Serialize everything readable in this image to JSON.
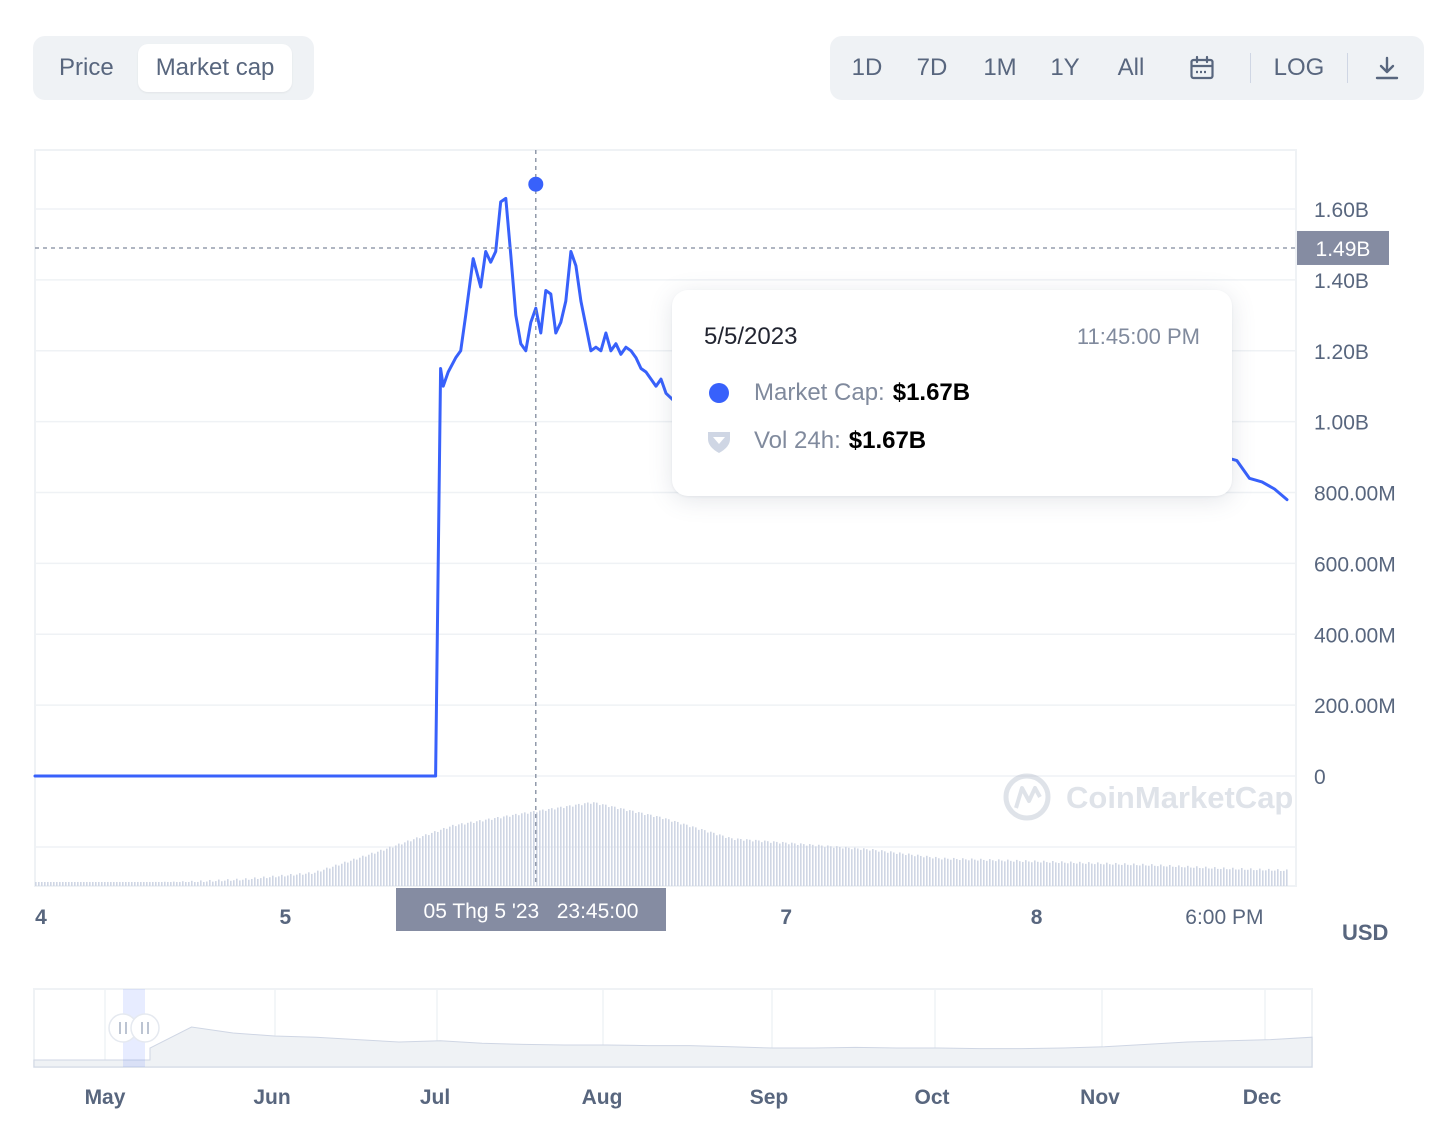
{
  "toggle": {
    "items": [
      {
        "label": "Price",
        "active": false
      },
      {
        "label": "Market cap",
        "active": true
      }
    ]
  },
  "range": {
    "items": [
      "1D",
      "7D",
      "1M",
      "1Y",
      "All"
    ],
    "calendar_icon": "calendar-icon",
    "log_label": "LOG",
    "download_icon": "download-icon"
  },
  "tooltip": {
    "date": "5/5/2023",
    "time": "11:45:00 PM",
    "market_cap_label": "Market Cap:",
    "market_cap_value": "$1.67B",
    "vol_label": "Vol 24h:",
    "vol_value": "$1.67B"
  },
  "currency": "USD",
  "watermark": "CoinMarketCap",
  "colors": {
    "line": "#3861fb",
    "axis_text": "#58667e",
    "grid": "#eff2f5",
    "crosshair_label_bg": "#858ca2",
    "volume": "#cfd6e4",
    "navigator_fill": "#eff2f5"
  },
  "chart_data": {
    "type": "line",
    "series": [
      {
        "name": "Market Cap",
        "x": [
          4.0,
          5.6,
          5.62,
          5.63,
          5.65,
          5.68,
          5.7,
          5.72,
          5.75,
          5.78,
          5.8,
          5.82,
          5.84,
          5.86,
          5.88,
          5.9,
          5.92,
          5.94,
          5.96,
          5.98,
          6.0,
          6.02,
          6.04,
          6.06,
          6.08,
          6.1,
          6.12,
          6.14,
          6.16,
          6.18,
          6.2,
          6.22,
          6.24,
          6.26,
          6.28,
          6.3,
          6.32,
          6.34,
          6.36,
          6.38,
          6.4,
          6.42,
          6.44,
          6.46,
          6.48,
          6.5,
          6.52,
          6.55,
          6.6,
          6.7,
          6.8,
          6.9,
          7.0,
          7.1,
          7.2,
          7.3,
          7.4,
          7.5,
          7.6,
          7.7,
          7.8,
          7.9,
          8.0,
          8.1,
          8.2,
          8.3,
          8.4,
          8.5,
          8.6,
          8.7,
          8.75,
          8.8,
          8.85,
          8.9,
          8.95,
          9.0
        ],
        "y": [
          0,
          0,
          1.15,
          1.1,
          1.14,
          1.18,
          1.2,
          1.3,
          1.46,
          1.38,
          1.48,
          1.45,
          1.48,
          1.62,
          1.63,
          1.47,
          1.3,
          1.22,
          1.2,
          1.28,
          1.32,
          1.25,
          1.37,
          1.36,
          1.25,
          1.28,
          1.34,
          1.48,
          1.44,
          1.34,
          1.27,
          1.2,
          1.21,
          1.2,
          1.25,
          1.2,
          1.22,
          1.19,
          1.21,
          1.2,
          1.18,
          1.15,
          1.14,
          1.12,
          1.1,
          1.12,
          1.08,
          1.06,
          1.04,
          1.02,
          1.0,
          0.99,
          0.98,
          0.97,
          0.97,
          0.96,
          0.95,
          0.95,
          0.94,
          0.94,
          0.93,
          0.93,
          0.92,
          0.92,
          0.92,
          0.91,
          0.92,
          0.91,
          0.91,
          0.92,
          0.9,
          0.89,
          0.84,
          0.83,
          0.81,
          0.78
        ]
      }
    ],
    "volume_profile": [
      0.02,
      0.02,
      0.03,
      0.06,
      0.12,
      0.33,
      0.55,
      0.66,
      0.76,
      0.62,
      0.43,
      0.38,
      0.33,
      0.25,
      0.23,
      0.21,
      0.19,
      0.16,
      0.14
    ],
    "x_ticks": [
      "4",
      "5",
      "7",
      "8",
      "6:00 PM"
    ],
    "x_tick_positions": [
      4,
      5,
      7,
      8,
      8.75
    ],
    "y_ticks": [
      "0",
      "200.00M",
      "400.00M",
      "600.00M",
      "800.00M",
      "1.00B",
      "1.20B",
      "1.40B",
      "1.60B"
    ],
    "y_tick_values": [
      0,
      0.2,
      0.4,
      0.6,
      0.8,
      1.0,
      1.2,
      1.4,
      1.6
    ],
    "ylim": [
      0,
      1.78
    ],
    "crosshair": {
      "x": 6.0,
      "y_label": "1.49B",
      "y_value": 1.49,
      "x_label": "05 Thg 5 '23   23:45:00"
    },
    "highlight_point": {
      "x": 6.0,
      "y": 1.67
    },
    "navigator": {
      "months": [
        "May",
        "Jun",
        "Jul",
        "Aug",
        "Sep",
        "Oct",
        "Nov",
        "Dec"
      ],
      "profile": [
        0.2,
        0.55,
        0.45,
        0.4,
        0.38,
        0.34,
        0.3,
        0.32,
        0.28,
        0.26,
        0.25,
        0.25,
        0.24,
        0.24,
        0.22,
        0.2,
        0.2,
        0.21,
        0.2,
        0.2,
        0.19,
        0.19,
        0.2,
        0.22,
        0.26,
        0.3,
        0.32,
        0.34,
        0.38
      ]
    },
    "grid": true,
    "legend": "none"
  }
}
